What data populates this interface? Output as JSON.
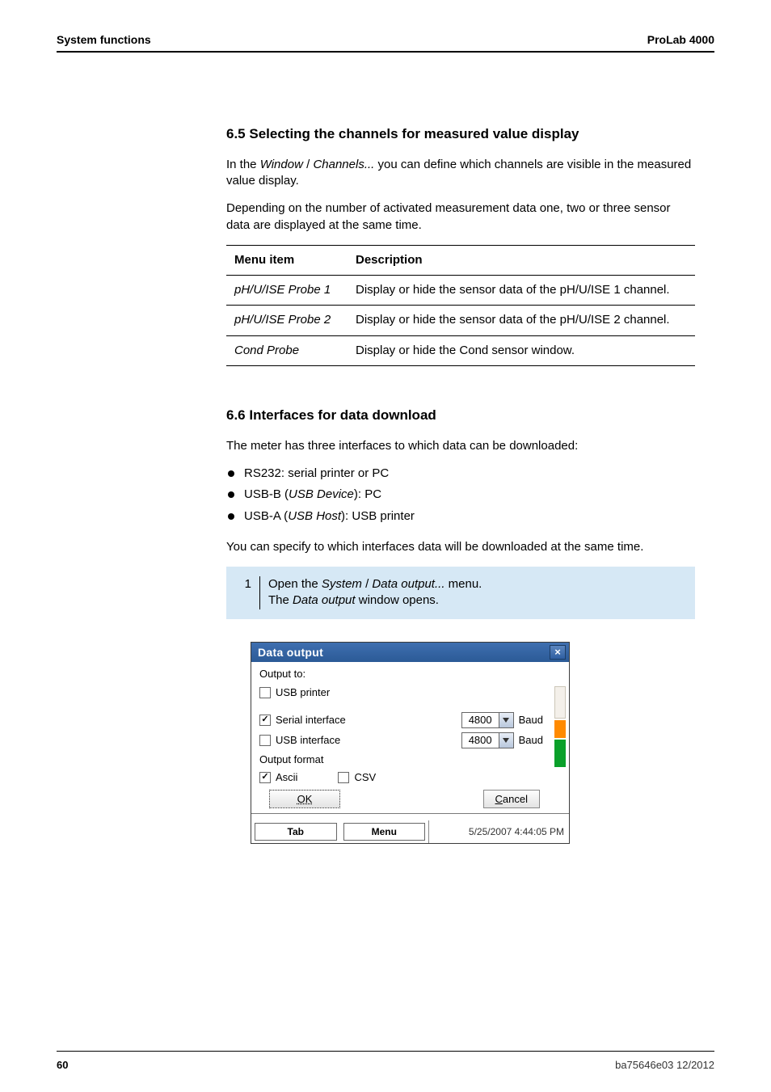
{
  "header": {
    "left": "System functions",
    "right": "ProLab 4000"
  },
  "sec65": {
    "heading": "6.5    Selecting the channels for measured value display",
    "p1_a": "In the ",
    "p1_w": "Window",
    "p1_sep": " / ",
    "p1_c": "Channels...",
    "p1_b": " you can define which channels are visible in the measured value display.",
    "p2": "Depending on the number of activated measurement data one, two or three sensor data are displayed at the same time."
  },
  "menuTable": {
    "h1": "Menu item",
    "h2": "Description",
    "rows": [
      {
        "item": "pH/U/ISE Probe 1",
        "desc": "Display or hide the sensor data of the pH/U/ISE 1 channel."
      },
      {
        "item": "pH/U/ISE Probe 2",
        "desc": "Display or hide the sensor data of the pH/U/ISE 2 channel."
      },
      {
        "item": "Cond Probe",
        "desc": "Display or hide the Cond sensor window."
      }
    ]
  },
  "sec66": {
    "heading": "6.6    Interfaces for data download",
    "intro": "The meter has three interfaces to which data can be downloaded:",
    "b1": "RS232: serial printer or PC",
    "b2_a": "USB-B (",
    "b2_i": "USB Device",
    "b2_b": "): PC",
    "b3_a": "USB-A (",
    "b3_i": "USB Host",
    "b3_b": "): USB printer",
    "p2": "You can specify to which interfaces data will be downloaded at the same time."
  },
  "step1": {
    "num": "1",
    "t1": "Open the ",
    "sys": "System",
    "sep": " / ",
    "menu": "Data output...",
    "t2": " menu.",
    "line2a": "The ",
    "line2i": "Data output",
    "line2b": " window opens."
  },
  "dialog": {
    "title": "Data output",
    "outputto": "Output to:",
    "usb_printer": "USB printer",
    "serial_if": "Serial interface",
    "usb_if": "USB interface",
    "out_fmt": "Output format",
    "ascii": "Ascii",
    "csv": "CSV",
    "baud": "Baud",
    "baud1": "4800",
    "baud2": "4800",
    "ok": "OK",
    "cancel": "Cancel",
    "clock": "5/25/2007 4:44:05 PM",
    "tab": "Tab",
    "menu": "Menu",
    "close_x": "×"
  },
  "footer": {
    "pageno": "60",
    "rev": "ba75646e03       12/2012"
  }
}
